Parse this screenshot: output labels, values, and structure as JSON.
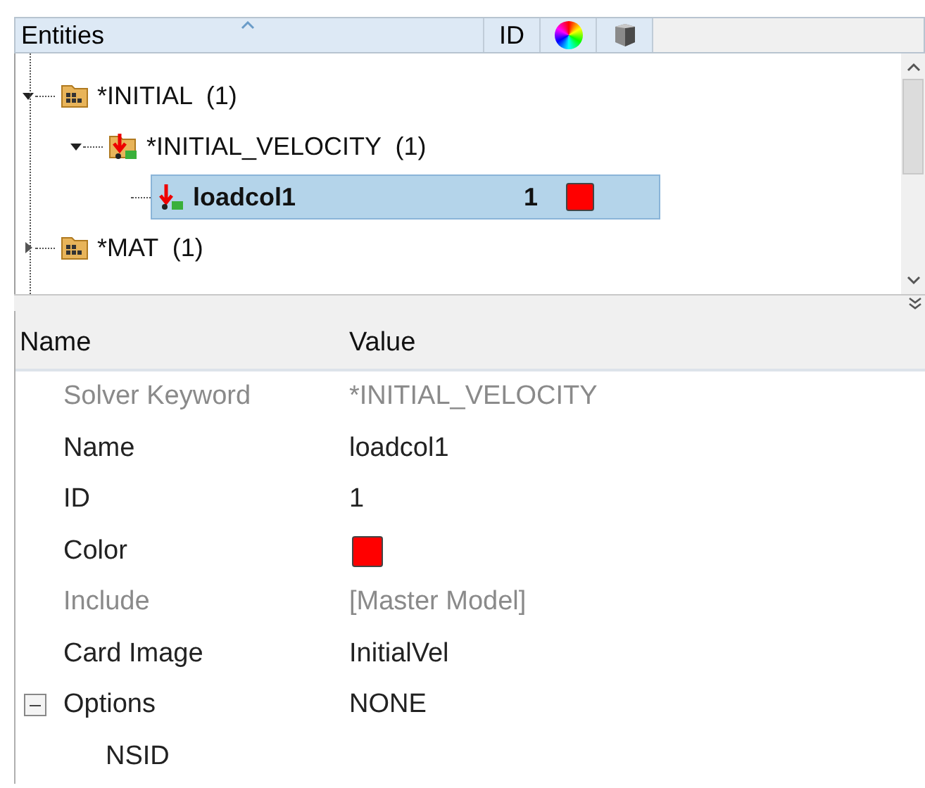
{
  "entity_browser": {
    "columns": [
      {
        "kind": "label",
        "label": "Entities"
      },
      {
        "kind": "label",
        "label": "ID"
      },
      {
        "kind": "color_icon"
      },
      {
        "kind": "cube_icon"
      }
    ],
    "tree": [
      {
        "kind": "folder",
        "label": "*INITIAL  (1)",
        "expanded": true,
        "selected": false,
        "children": [
          {
            "kind": "load_folder",
            "label": "*INITIAL_VELOCITY  (1)",
            "expanded": true,
            "selected": false,
            "children": [
              {
                "kind": "load",
                "label": "loadcol1",
                "id": "1",
                "color": "#ff0000",
                "selected": true
              }
            ]
          }
        ]
      },
      {
        "kind": "folder",
        "label": "*MAT  (1)",
        "expanded": false,
        "selected": false
      }
    ]
  },
  "properties": {
    "columns": [
      "Name",
      "Value"
    ],
    "rows": [
      {
        "kind": "text",
        "name": "Solver Keyword",
        "value": "*INITIAL_VELOCITY",
        "disabled": true
      },
      {
        "kind": "text",
        "name": "Name",
        "value": "loadcol1",
        "disabled": false
      },
      {
        "kind": "text",
        "name": "ID",
        "value": "1",
        "disabled": false
      },
      {
        "kind": "color",
        "name": "Color",
        "color": "#ff0000",
        "disabled": false
      },
      {
        "kind": "text",
        "name": "Include",
        "value": "[Master Model]",
        "disabled": true
      },
      {
        "kind": "text",
        "name": "Card Image",
        "value": "InitialVel",
        "disabled": false
      },
      {
        "kind": "group",
        "name": "Options",
        "value": "NONE",
        "expanded": true,
        "disabled": false,
        "children": [
          {
            "name": "NSID",
            "disabled": false
          }
        ]
      }
    ]
  }
}
